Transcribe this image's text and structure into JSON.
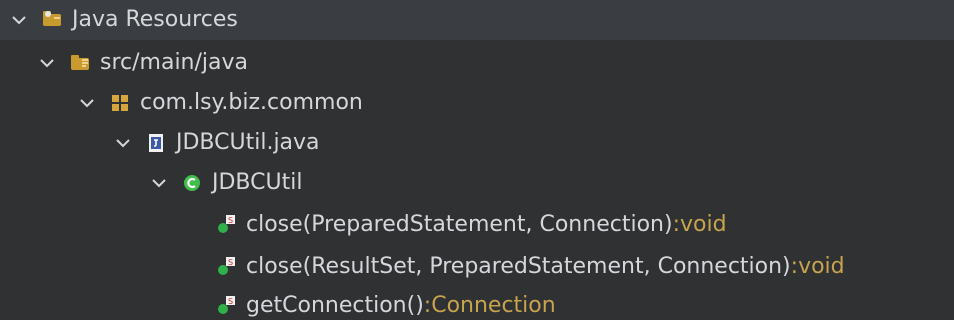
{
  "tree": {
    "items": [
      {
        "label": "Java Resources",
        "icon": "java-resources-icon"
      },
      {
        "label": "src/main/java",
        "icon": "source-folder-icon"
      },
      {
        "label": "com.lsy.biz.common",
        "icon": "package-icon"
      },
      {
        "label": "JDBCUtil.java",
        "icon": "java-file-icon"
      },
      {
        "label": "JDBCUtil",
        "icon": "class-icon"
      },
      {
        "label": "close(PreparedStatement, Connection)",
        "sep": " : ",
        "type": "void",
        "icon": "static-method-icon"
      },
      {
        "label": "close(ResultSet, PreparedStatement, Connection)",
        "sep": " : ",
        "type": "void",
        "icon": "static-method-icon"
      },
      {
        "label": "getConnection()",
        "sep": " : ",
        "type": "Connection",
        "icon": "static-method-icon"
      }
    ]
  },
  "colors": {
    "background": "#2f3133",
    "selectedRow": "#3a3d41",
    "text": "#d5d7db",
    "typeText": "#c7a34d"
  }
}
